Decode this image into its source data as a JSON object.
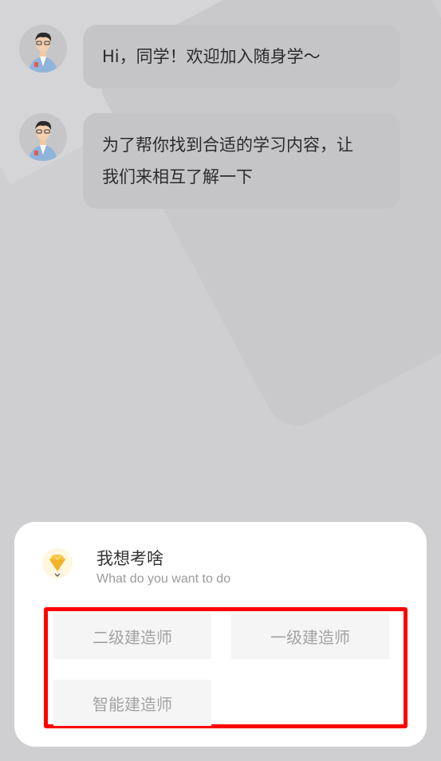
{
  "chat": {
    "messages": [
      {
        "text": "Hi，同学！欢迎加入随身学～"
      },
      {
        "line1": "为了帮你找到合适的学习内容，让",
        "line2": "我们来相互了解一下"
      }
    ]
  },
  "panel": {
    "title": "我想考啥",
    "subtitle": "What do you want to do",
    "icon": "diamond-icon",
    "options": [
      {
        "label": "二级建造师"
      },
      {
        "label": "一级建造师"
      },
      {
        "label": "智能建造师"
      }
    ]
  },
  "colors": {
    "background": "#cfcfd1",
    "bubble": "#c5c5c8",
    "highlight_border": "#ff0000",
    "option_bg": "#f5f5f5",
    "icon_gold": "#f5c542"
  }
}
